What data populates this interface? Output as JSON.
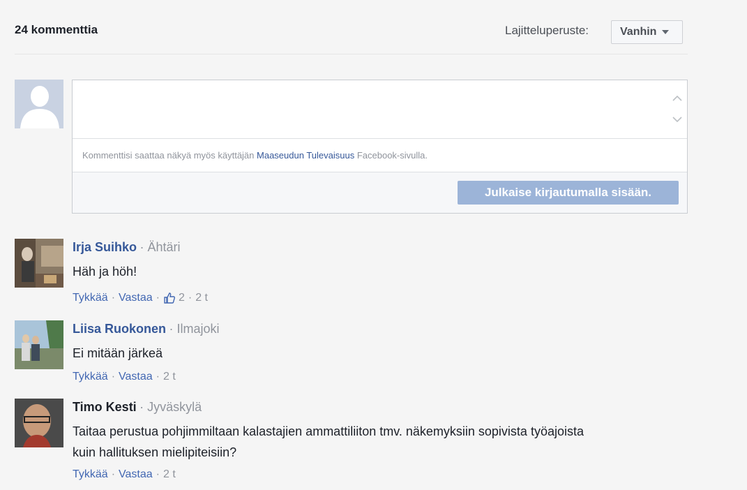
{
  "header": {
    "comment_count": "24 kommenttia",
    "sort_label": "Lajitteluperuste:",
    "sort_value": "Vanhin"
  },
  "composer": {
    "notice_prefix": "Kommenttisi saattaa näkyä myös käyttäjän",
    "page_name": "Maaseudun Tulevaisuus",
    "notice_suffix": "Facebook-sivulla.",
    "post_button": "Julkaise kirjautumalla sisään."
  },
  "comments": [
    {
      "author": "Irja Suihko",
      "location": "Ähtäri",
      "text": "Häh ja höh!",
      "like": "Tykkää",
      "reply": "Vastaa",
      "likes": "2",
      "time": "2 t"
    },
    {
      "author": "Liisa Ruokonen",
      "location": "Ilmajoki",
      "text": "Ei mitään järkeä",
      "like": "Tykkää",
      "reply": "Vastaa",
      "time": "2 t"
    },
    {
      "author": "Timo Kesti",
      "location": "Jyväskylä",
      "text_line1": "Taitaa perustua pohjimmiltaan kalastajien ammattiliiton tmv. näkemyksiin sopivista työajoista",
      "text_line2": "kuin hallituksen mielipiteisiin?",
      "like": "Tykkää",
      "reply": "Vastaa",
      "time": "2 t"
    }
  ],
  "colors": {
    "link": "#365899",
    "action": "#4267b2",
    "muted": "#90949c",
    "button_disabled": "#9cb4d8"
  }
}
